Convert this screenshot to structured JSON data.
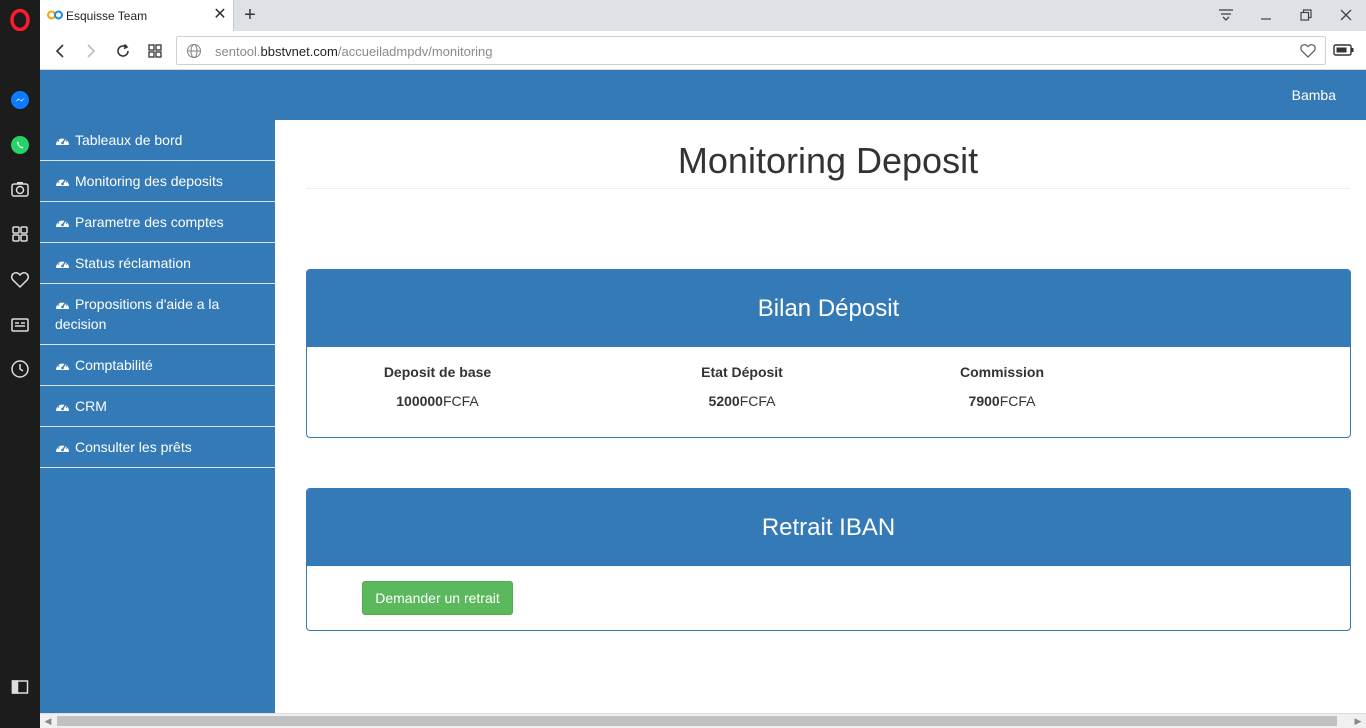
{
  "browser": {
    "tab_title": "Esquisse Team",
    "tab_close": "✕",
    "new_tab": "+",
    "url_prefix": "sentool.",
    "url_domain": "bbstvnet.com",
    "url_path": "/accueiladmpdv/monitoring"
  },
  "header": {
    "user_name": "Bamba"
  },
  "sidebar": {
    "items": [
      {
        "label": "Tableaux de bord"
      },
      {
        "label": "Monitoring des deposits"
      },
      {
        "label": "Parametre des comptes"
      },
      {
        "label": "Status réclamation"
      },
      {
        "label": "Propositions d'aide a la decision"
      },
      {
        "label": "Comptabilité"
      },
      {
        "label": "CRM"
      },
      {
        "label": "Consulter les prêts"
      }
    ]
  },
  "main": {
    "title": "Monitoring Deposit",
    "bilan": {
      "heading": "Bilan Déposit",
      "stats": [
        {
          "label": "Deposit de base",
          "amount": "100000",
          "unit": "FCFA"
        },
        {
          "label": "Etat Déposit",
          "amount": "5200",
          "unit": "FCFA"
        },
        {
          "label": "Commission",
          "amount": "7900",
          "unit": "FCFA"
        }
      ]
    },
    "retrait": {
      "heading": "Retrait IBAN",
      "button_label": "Demander un retrait"
    }
  },
  "colors": {
    "primary": "#337ab7",
    "success": "#5cb85c",
    "opera_bar": "#1c1c1c",
    "opera_red": "#ff1b2d"
  },
  "icons": {
    "menu": "gauge-icon",
    "opera": "opera-logo-icon",
    "messenger": "messenger-icon",
    "whatsapp": "whatsapp-icon"
  }
}
